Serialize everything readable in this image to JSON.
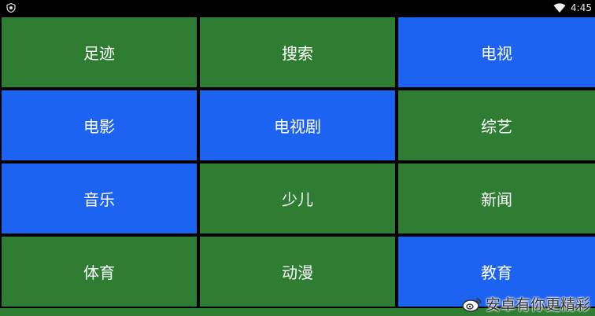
{
  "status_bar": {
    "time": "4:45",
    "left_icon": "shield-icon",
    "wifi_icon": "wifi-icon"
  },
  "colors": {
    "green": "#2e7d32",
    "blue": "#1d63f2",
    "background": "#000000"
  },
  "tiles": [
    {
      "label": "足迹",
      "color": "green"
    },
    {
      "label": "搜索",
      "color": "green"
    },
    {
      "label": "电视",
      "color": "blue"
    },
    {
      "label": "电影",
      "color": "blue"
    },
    {
      "label": "电视剧",
      "color": "blue"
    },
    {
      "label": "综艺",
      "color": "green"
    },
    {
      "label": "音乐",
      "color": "blue"
    },
    {
      "label": "少儿",
      "color": "green"
    },
    {
      "label": "新闻",
      "color": "green"
    },
    {
      "label": "体育",
      "color": "green"
    },
    {
      "label": "动漫",
      "color": "green"
    },
    {
      "label": "教育",
      "color": "blue"
    }
  ],
  "watermark": {
    "text": "安卓有你更精彩",
    "icon": "weibo-icon"
  }
}
